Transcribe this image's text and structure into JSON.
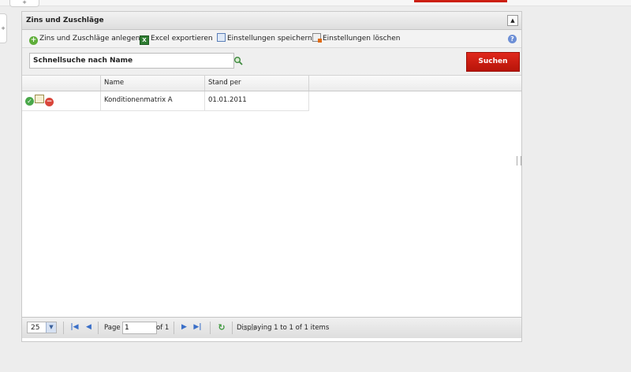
{
  "top": {
    "tab_glyph": "+",
    "side_glyph": "+"
  },
  "panel": {
    "title": "Zins und Zuschläge",
    "collapse_glyph": "▲"
  },
  "toolbar": {
    "add_label": "Zins und Zuschläge anlegen",
    "excel_label": "Excel exportieren",
    "save_settings_label": "Einstellungen speichern",
    "delete_settings_label": "Einstellungen löschen",
    "help_glyph": "?"
  },
  "search": {
    "value": "Schnellsuche nach Name",
    "button_label": "Suchen"
  },
  "grid": {
    "columns": [
      "",
      "Name",
      "Stand per"
    ],
    "rows": [
      {
        "name": "Konditionenmatrix A",
        "stand_per": "01.01.2011"
      }
    ]
  },
  "pager": {
    "page_size": "25",
    "page_label": "Page",
    "page_value": "1",
    "of_label": "of 1",
    "status": "Displaying 1 to 1 of 1 items"
  },
  "colors": {
    "accent_red": "#cc1f10",
    "add_green": "#5fae3a",
    "excel_green": "#2f7d32",
    "nav_blue": "#3a6fc8"
  }
}
